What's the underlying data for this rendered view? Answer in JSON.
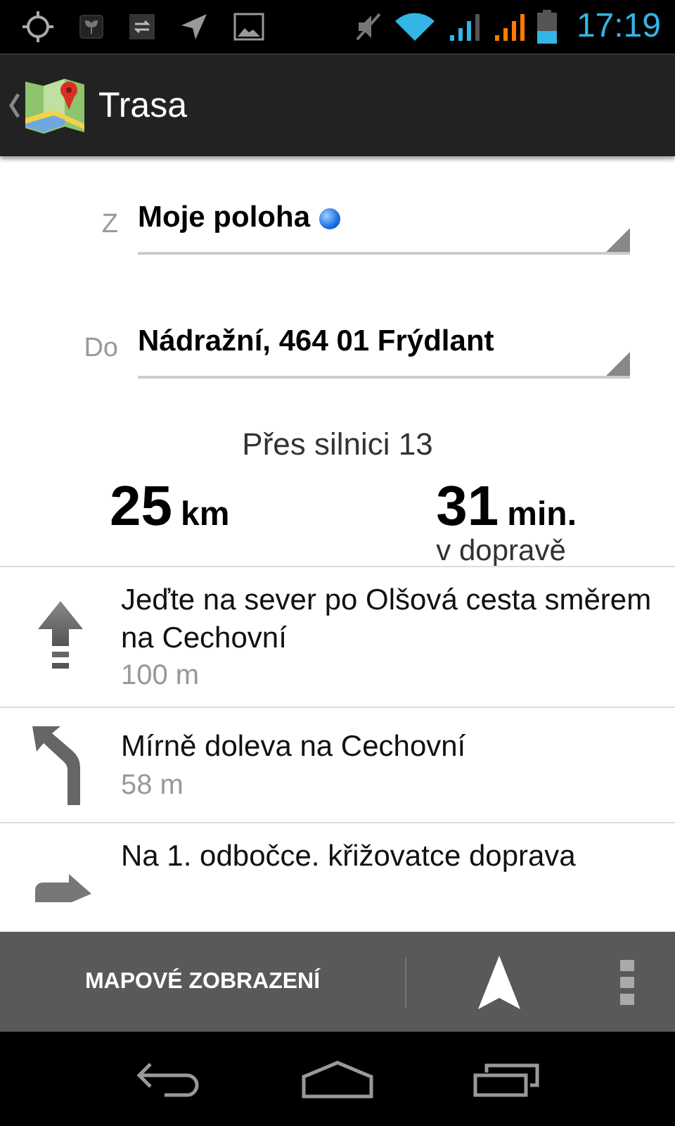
{
  "status_bar": {
    "time": "17:19"
  },
  "action_bar": {
    "title": "Trasa"
  },
  "route": {
    "from": {
      "label": "Z",
      "value": "Moje poloha"
    },
    "to": {
      "label": "Do",
      "value": "Nádražní, 464 01 Frýdlant"
    },
    "via": "Přes silnici 13",
    "distance": {
      "number": "25",
      "unit": "km"
    },
    "duration": {
      "number": "31",
      "unit": "min.",
      "note": "v dopravě"
    }
  },
  "steps": [
    {
      "kind": "straight",
      "text": "Jeďte na sever po Olšová cesta směrem na Cechovní",
      "distance": "100 m"
    },
    {
      "kind": "slight_left",
      "text": "Mírně doleva na Cechovní",
      "distance": "58 m"
    },
    {
      "kind": "right",
      "text": "Na 1. odbočce. křižovatce doprava"
    }
  ],
  "bottom_bar": {
    "button": "MAPOVÉ ZOBRAZENÍ"
  }
}
